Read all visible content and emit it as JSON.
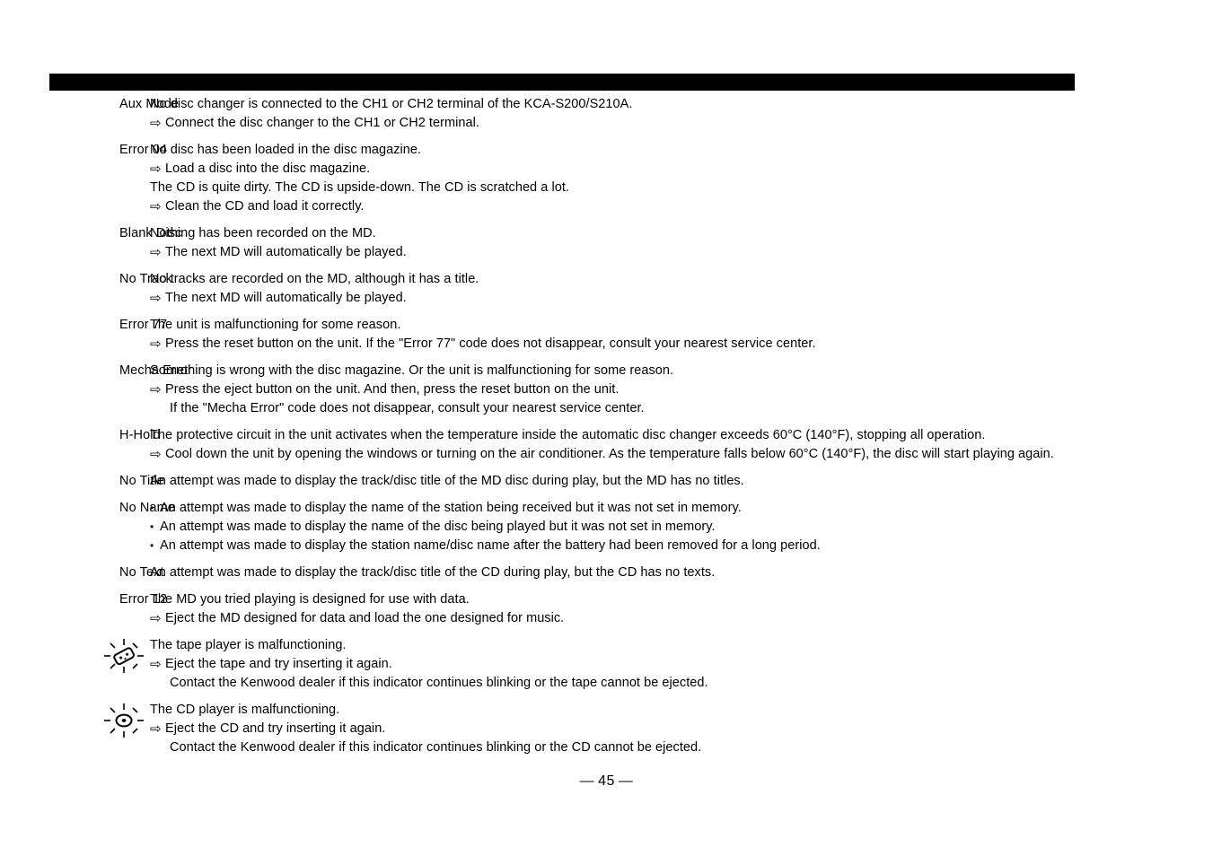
{
  "page": {
    "footer_left_dash": "—",
    "footer_page_number": "45",
    "footer_right_dash": "—",
    "header_bar_color": "#000000",
    "background_color": "#ffffff",
    "text_color": "#000000"
  },
  "glyphs": {
    "action_arrow": "⇨",
    "bullet": "•"
  },
  "rows": [
    {
      "label": "Aux Mode",
      "label_kind": "text",
      "lines": [
        {
          "kind": "plain",
          "text": "No disc changer is connected to the CH1 or CH2 terminal of the KCA-S200/S210A."
        },
        {
          "kind": "action",
          "text": "Connect the disc changer to the CH1 or CH2 terminal."
        }
      ]
    },
    {
      "label": "Error 04",
      "label_kind": "text",
      "lines": [
        {
          "kind": "plain",
          "text": "No disc has been loaded in the disc magazine."
        },
        {
          "kind": "action",
          "text": "Load a disc into the disc magazine."
        },
        {
          "kind": "plain",
          "text": "The CD is quite dirty. The CD is upside-down. The CD is scratched a lot."
        },
        {
          "kind": "action",
          "text": "Clean the CD and load it correctly."
        }
      ]
    },
    {
      "label": "Blank Disc",
      "label_kind": "text",
      "lines": [
        {
          "kind": "plain",
          "text": "Nothing has been recorded on the MD."
        },
        {
          "kind": "action",
          "text": "The next MD will automatically be played."
        }
      ]
    },
    {
      "label": "No Track",
      "label_kind": "text",
      "lines": [
        {
          "kind": "plain",
          "text": "No tracks are recorded on the MD, although it has a title."
        },
        {
          "kind": "action",
          "text": "The next MD will automatically be played."
        }
      ]
    },
    {
      "label": "Error 77",
      "label_kind": "text",
      "lines": [
        {
          "kind": "plain",
          "text": "The unit is malfunctioning for some reason."
        },
        {
          "kind": "action",
          "text": "Press the reset button on the unit. If the \"Error 77\" code does not disappear, consult your nearest service center."
        }
      ]
    },
    {
      "label": "Mecha Error",
      "label_kind": "text",
      "lines": [
        {
          "kind": "plain",
          "text": "Something is wrong with the disc magazine. Or the unit is malfunctioning for some reason."
        },
        {
          "kind": "action",
          "text": "Press the eject button on the unit. And then, press the reset button on the unit."
        },
        {
          "kind": "cont",
          "text": "If the \"Mecha Error\" code does not disappear, consult your nearest service center."
        }
      ]
    },
    {
      "label": "H-Hold",
      "label_kind": "text",
      "lines": [
        {
          "kind": "plain",
          "text": "The protective circuit in the unit activates when the temperature inside the automatic disc changer exceeds 60°C (140°F), stopping all operation."
        },
        {
          "kind": "action",
          "text": "Cool down the unit by opening the windows or turning on the air conditioner. As the temperature falls below 60°C (140°F), the disc will start playing again."
        }
      ]
    },
    {
      "label": "No Title",
      "label_kind": "text",
      "lines": [
        {
          "kind": "plain",
          "text": "An attempt was made to display the track/disc title of the MD disc during play, but the MD has no titles."
        }
      ]
    },
    {
      "label": "No Name",
      "label_kind": "text",
      "lines": [
        {
          "kind": "bullet",
          "text": "An attempt was made to display the name of the station being received but it was not set in memory."
        },
        {
          "kind": "bullet",
          "text": "An attempt was made to display the name of the disc being played but it was not set in memory."
        },
        {
          "kind": "bullet",
          "text": "An attempt was made to display the station name/disc name after the battery had been removed for a long period."
        }
      ]
    },
    {
      "label": "No Text",
      "label_kind": "text",
      "lines": [
        {
          "kind": "plain",
          "text": "An attempt was made to display the track/disc title of the CD during play, but the CD has no texts."
        }
      ]
    },
    {
      "label": "Error 12",
      "label_kind": "text",
      "lines": [
        {
          "kind": "plain",
          "text": "The MD you tried playing is designed for use with data."
        },
        {
          "kind": "action",
          "text": "Eject the MD designed for data and load the one designed for music."
        }
      ]
    },
    {
      "label": "",
      "label_kind": "icon",
      "icon_name": "blinking-cassette-tape-icon",
      "lines": [
        {
          "kind": "plain",
          "text": "The tape player is malfunctioning."
        },
        {
          "kind": "action",
          "text": "Eject the tape and try inserting it again."
        },
        {
          "kind": "cont",
          "text": "Contact the Kenwood dealer if this indicator continues blinking or the tape cannot be ejected."
        }
      ]
    },
    {
      "label": "",
      "label_kind": "icon",
      "icon_name": "blinking-disc-icon",
      "lines": [
        {
          "kind": "plain",
          "text": "The CD player is malfunctioning."
        },
        {
          "kind": "action",
          "text": "Eject the CD and try inserting it again."
        },
        {
          "kind": "cont",
          "text": "Contact the Kenwood dealer if this indicator continues blinking or the CD cannot be ejected."
        }
      ]
    }
  ]
}
